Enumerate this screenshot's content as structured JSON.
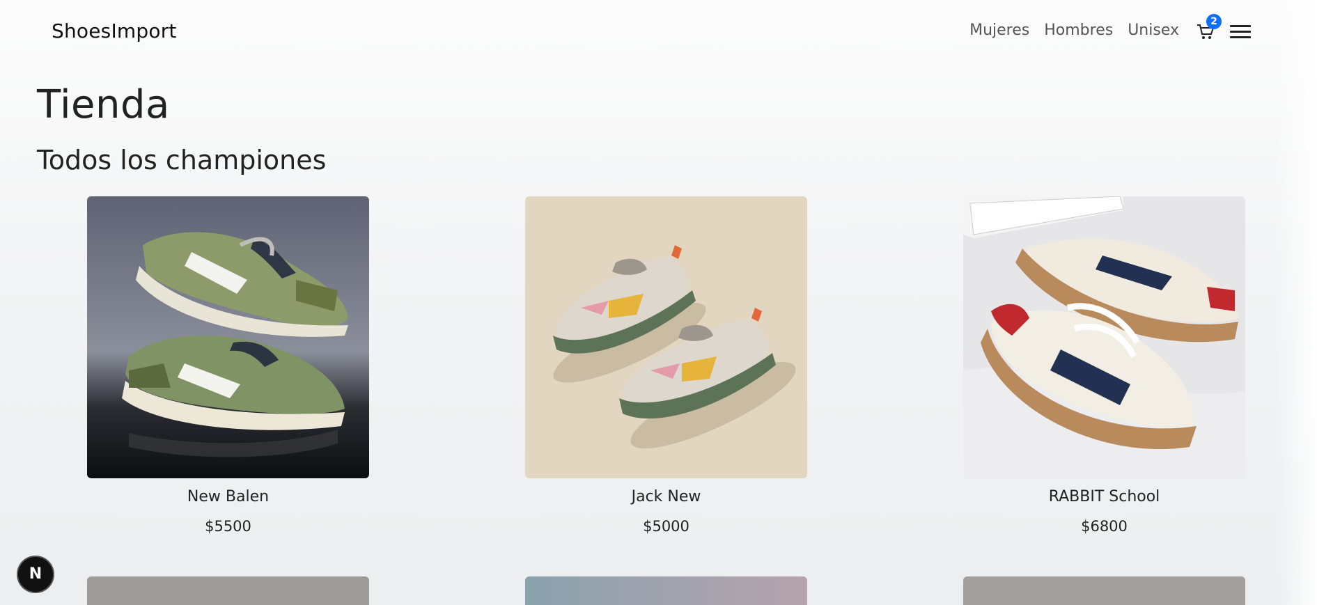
{
  "brand": "ShoesImport",
  "nav": {
    "links": [
      "Mujeres",
      "Hombres",
      "Unisex"
    ],
    "cart_count": "2",
    "cart_icon": "shopping-cart-icon",
    "menu_icon": "hamburger-menu-icon"
  },
  "page": {
    "title": "Tienda",
    "section_title": "Todos los championes"
  },
  "products": [
    {
      "name": "New Balen",
      "price": "$5500"
    },
    {
      "name": "Jack New",
      "price": "$5000"
    },
    {
      "name": "RABBIT School",
      "price": "$6800"
    }
  ],
  "next_badge": {
    "letter": "N"
  },
  "colors": {
    "accent": "#0d6efd",
    "text": "#222222",
    "badge_bg": "#111111"
  }
}
